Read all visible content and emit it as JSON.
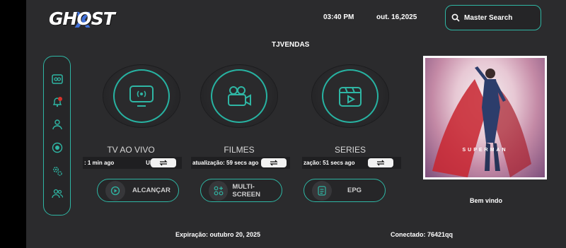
{
  "header": {
    "logo_text": "GHOST",
    "time": "03:40 PM",
    "date": "out. 16,2025",
    "search_label": "Master Search"
  },
  "center_title": "TJVENDAS",
  "tiles": [
    {
      "label": "TV AO VIVO",
      "status_text": "­: 1 min ago",
      "status_extra": "Ulti"
    },
    {
      "label": "FILMES",
      "status_text": "atualização: 59 secs ago"
    },
    {
      "label": "SERIES",
      "status_text": "zação: 51 secs ago"
    }
  ],
  "pills": [
    {
      "label": "ALCANÇAR"
    },
    {
      "label": "MULTI-SCREEN"
    },
    {
      "label": "EPG"
    }
  ],
  "poster_title": "SUPERMAN",
  "welcome": "Bem vindo",
  "footer": {
    "expiration": "Expiração: outubro 20, 2025",
    "connected": "Conectado: 76421qq"
  },
  "colors": {
    "accent": "#2fb6a4",
    "background": "#2b2b2d",
    "logo_x": "#3f6fd8"
  }
}
